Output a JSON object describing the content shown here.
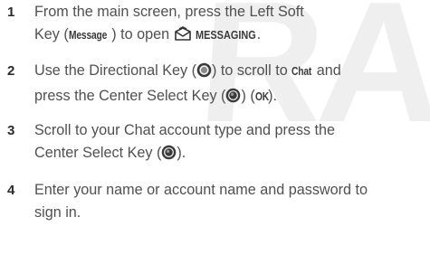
{
  "watermark": {
    "text": "RA"
  },
  "steps": [
    {
      "number": "1",
      "l1_a": "From the main screen, press the Left Soft",
      "l2_a": "Key (",
      "l2_key": "Message",
      "l2_b": ") to open",
      "l2_menu": "MESSAGING",
      "l2_c": "."
    },
    {
      "number": "2",
      "l1_a": "Use the Directional Key (",
      "l1_b": ") to scroll to",
      "l1_item": "Chat",
      "l1_c": "and",
      "l2_a": "press the Center Select Key (",
      "l2_b": ") (",
      "l2_key": "OK",
      "l2_c": ")."
    },
    {
      "number": "3",
      "l1_a": "Scroll to your Chat account type and press the",
      "l2_a": "Center Select Key (",
      "l2_b": ")."
    },
    {
      "number": "4",
      "l1_a": "Enter your name or account name and password to",
      "l2_a": "sign in."
    }
  ],
  "icons": {
    "messaging": "messaging-envelope-icon",
    "nav_key": "directional-key-icon",
    "center_key": "center-select-key-icon"
  }
}
